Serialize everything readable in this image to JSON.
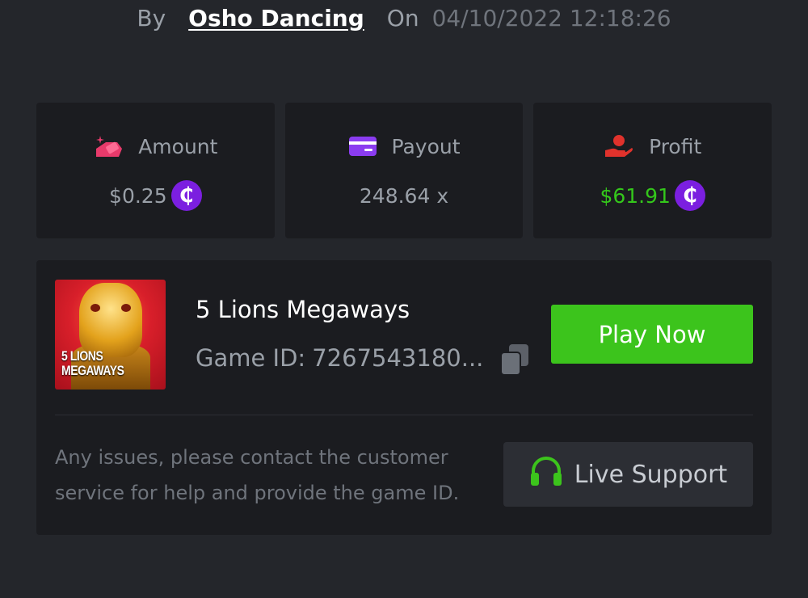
{
  "byline": {
    "by_label": "By",
    "username": "Osho Dancing",
    "on_label": "On",
    "datetime": "04/10/2022 12:18:26"
  },
  "stats": {
    "amount": {
      "label": "Amount",
      "value": "$0.25",
      "icon": "amount-icon",
      "color": "#e83a6b",
      "currency_icon": "coin-icon"
    },
    "payout": {
      "label": "Payout",
      "value": "248.64 x",
      "icon": "card-icon",
      "color": "#8b3cf0"
    },
    "profit": {
      "label": "Profit",
      "value": "$61.91",
      "icon": "hand-coin-icon",
      "color": "#e0322c",
      "value_color": "#34c71b",
      "currency_icon": "coin-icon"
    },
    "coin_symbol": "₵",
    "coin_color": "#7b1fe0"
  },
  "game": {
    "thumbnail_title": "5 LIONS\nMEGAWAYS",
    "name": "5 Lions Megaways",
    "id_label": "Game ID:",
    "id_value": "7267543180...",
    "play_label": "Play Now",
    "play_color": "#3cc41c"
  },
  "support": {
    "note": "Any issues, please contact the customer service for help and provide the game ID.",
    "button_label": "Live Support",
    "icon": "headset-icon",
    "icon_color": "#3cc41c"
  },
  "colors": {
    "background": "#24262b",
    "panel": "#1b1c20",
    "muted_text": "#9aa0a8"
  }
}
